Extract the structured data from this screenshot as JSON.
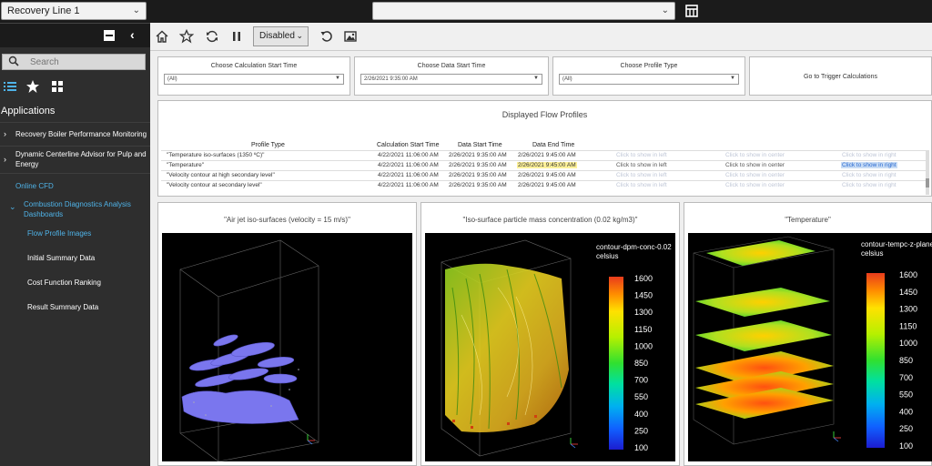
{
  "topbar": {
    "line_select": "Recovery Line 1",
    "top_select": ""
  },
  "sidebar": {
    "search_placeholder": "Search",
    "apps_title": "Applications",
    "items": [
      {
        "label": "Recovery Boiler Performance Monitoring"
      },
      {
        "label_1": "Dynamic Centerline Advisor for Pulp and",
        "label_2": "Energy"
      },
      {
        "label": "Online CFD"
      }
    ],
    "group": {
      "label_1": "Combustion Diagnostics Analysis",
      "label_2": "Dashboards"
    },
    "sub_items": [
      {
        "label": "Flow Profile Images"
      },
      {
        "label": "Initial Summary Data"
      },
      {
        "label": "Cost Function Ranking"
      },
      {
        "label": "Result Summary Data"
      }
    ],
    "colors": {
      "active": "#4fb3e8",
      "bg": "#2e2e2e"
    }
  },
  "toolbar": {
    "state_label": "Disabled"
  },
  "filters": [
    {
      "title": "Choose Calculation Start Time",
      "value": "(All)"
    },
    {
      "title": "Choose Data Start Time",
      "value": "2/26/2021 9:35:00 AM"
    },
    {
      "title": "Choose Profile Type",
      "value": "(All)"
    }
  ],
  "trigger_label": "Go to Trigger Calculations",
  "profiles": {
    "title": "Displayed Flow Profiles",
    "headers": [
      "Profile Type",
      "Calculation Start Time",
      "Data Start Time",
      "Data End Time"
    ],
    "rows": [
      {
        "type": "\"Temperature iso-surfaces (1350 ºC)\"",
        "calc": "4/22/2021 11:06:00 AM",
        "start": "2/26/2021 9:35:00 AM",
        "end": "2/26/2021 9:45:00 AM",
        "left": "Click to show in left",
        "center": "Click to show in center",
        "right": "Click to show in right"
      },
      {
        "type": "\"Temperature\"",
        "calc": "4/22/2021 11:06:00 AM",
        "start": "2/26/2021 9:35:00 AM",
        "end": "2/26/2021 9:45:00 AM",
        "left": "Click to show in left",
        "center": "Click to show in center",
        "right": "Click to show in right"
      },
      {
        "type": "\"Velocity contour at high secondary level\"",
        "calc": "4/22/2021 11:06:00 AM",
        "start": "2/26/2021 9:35:00 AM",
        "end": "2/26/2021 9:45:00 AM",
        "left": "Click to show in left",
        "center": "Click to show in center",
        "right": "Click to show in right"
      },
      {
        "type": "\"Velocity contour at secondary level\"",
        "calc": "4/22/2021 11:06:00 AM",
        "start": "2/26/2021 9:35:00 AM",
        "end": "2/26/2021 9:45:00 AM",
        "left": "Click to show in left",
        "center": "Click to show in center",
        "right": "Click to show in right"
      }
    ]
  },
  "panels": [
    {
      "title": "\"Air jet iso-surfaces (velocity = 15 m/s)\""
    },
    {
      "title": "\"Iso-surface particle mass concentration (0.02 kg/m3)\"",
      "legend_1": "contour-dpm-conc-0.02",
      "legend_2": "celsius"
    },
    {
      "title": "\"Temperature\"",
      "legend_1": "contour-tempc-z-planes",
      "legend_2": "celsius"
    }
  ],
  "legend_ticks": [
    "1600",
    "1450",
    "1300",
    "1150",
    "1000",
    "850",
    "700",
    "550",
    "400",
    "250",
    "100"
  ]
}
